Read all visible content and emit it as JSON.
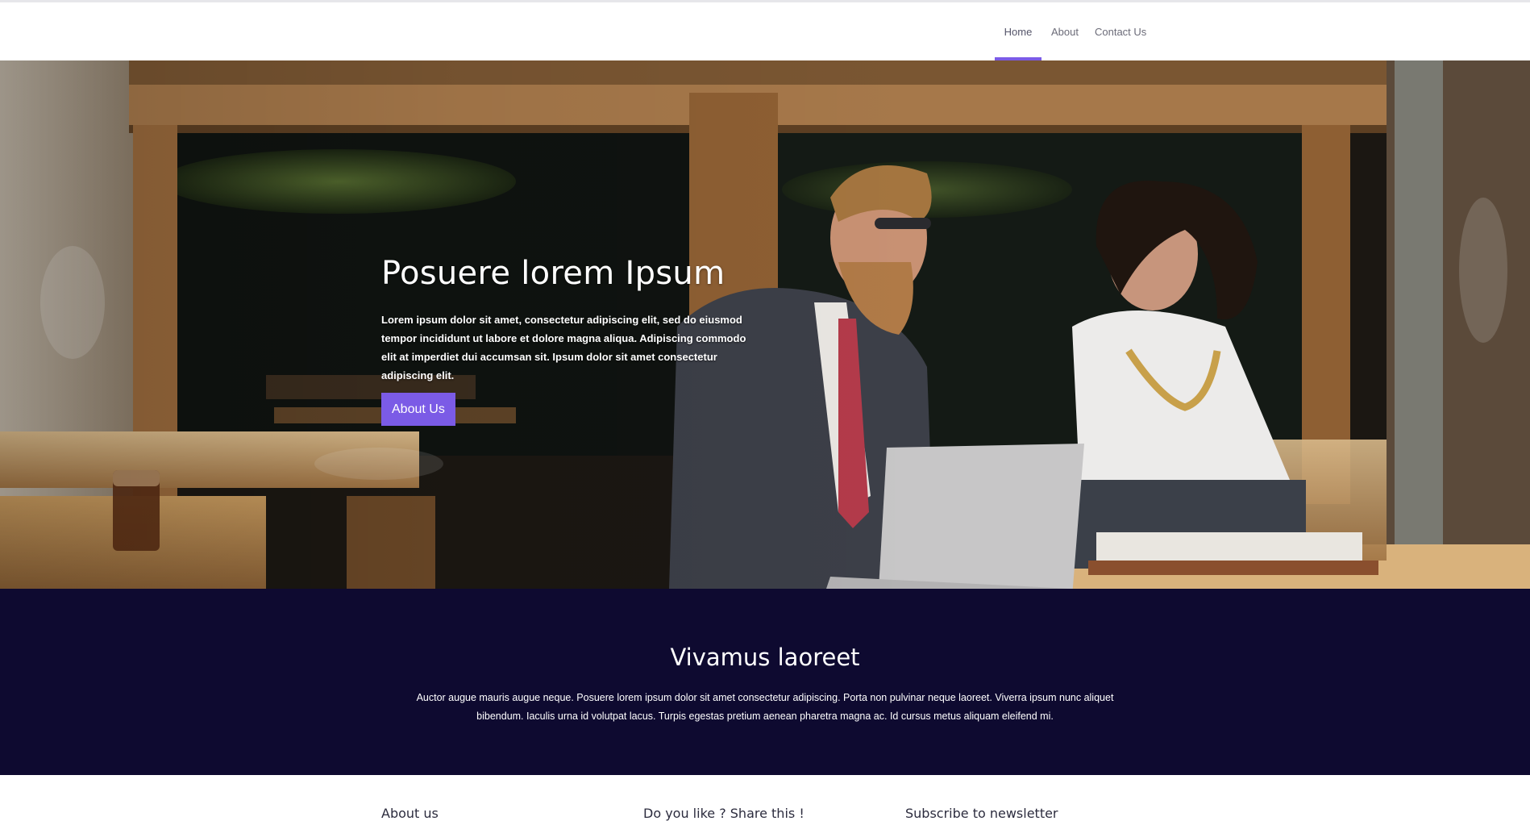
{
  "nav": {
    "items": [
      {
        "label": "Home",
        "active": true
      },
      {
        "label": "About"
      },
      {
        "label": "Contact Us"
      }
    ],
    "accent_color": "#7b5be6"
  },
  "hero": {
    "title": "Posuere lorem Ipsum",
    "text": "Lorem ipsum dolor sit amet, consectetur adipiscing elit, sed do eiusmod tempor incididunt ut labore et dolore magna aliqua. Adipiscing commodo elit at imperdiet dui accumsan sit. Ipsum dolor sit amet consectetur adipiscing elit.",
    "button_label": "About Us",
    "background_image": "photo-two-people-working-on-laptop-at-cafe-table"
  },
  "band": {
    "title": "Vivamus laoreet",
    "text": "Auctor augue mauris augue neque. Posuere lorem ipsum dolor sit amet consectetur adipiscing. Porta non pulvinar neque laoreet. Viverra ipsum nunc aliquet bibendum. Iaculis urna id volutpat lacus. Turpis egestas pretium aenean pharetra magna ac. Id cursus metus aliquam eleifend mi.",
    "background_color": "#0e0a30"
  },
  "footer": {
    "columns": [
      {
        "title": "About us"
      },
      {
        "title": "Do you like ? Share this !"
      },
      {
        "title": "Subscribe to newsletter"
      }
    ]
  }
}
